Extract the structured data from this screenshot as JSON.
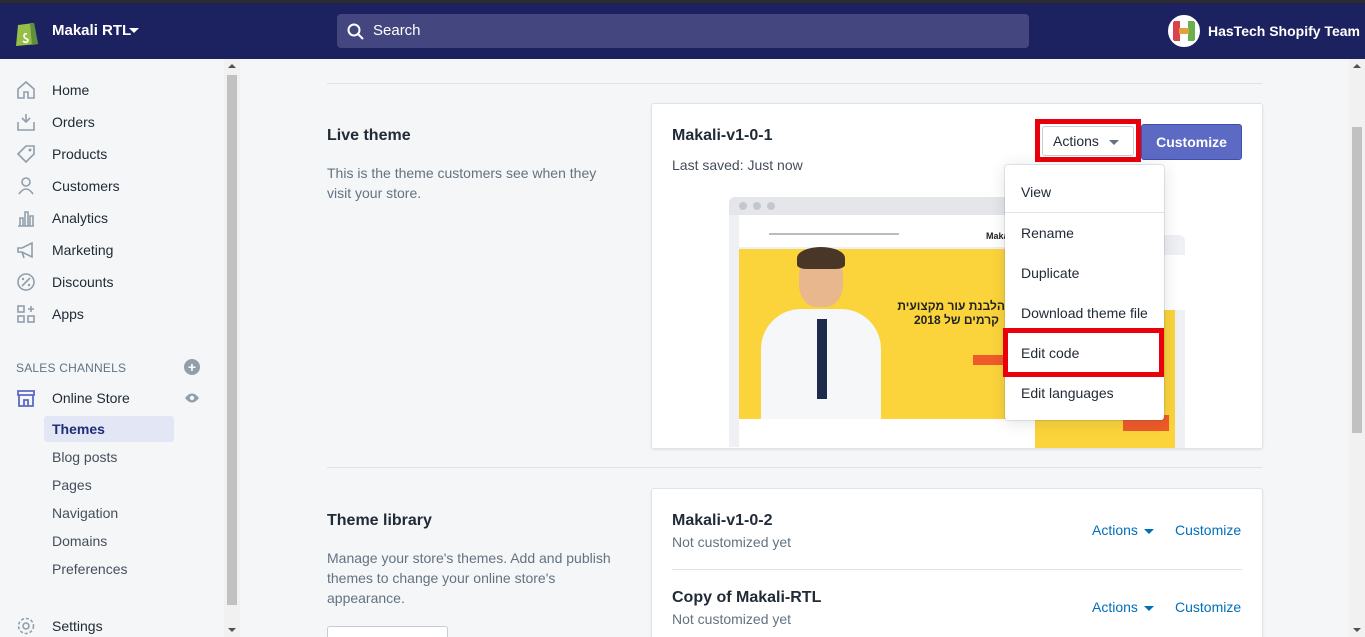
{
  "topbar": {
    "store_name": "Makali RTL",
    "search_placeholder": "Search",
    "user_name": "HasTech Shopify Team"
  },
  "sidebar": {
    "items": [
      {
        "label": "Home",
        "icon": "home-icon"
      },
      {
        "label": "Orders",
        "icon": "orders-icon"
      },
      {
        "label": "Products",
        "icon": "tag-icon"
      },
      {
        "label": "Customers",
        "icon": "customers-icon"
      },
      {
        "label": "Analytics",
        "icon": "bar-chart-icon"
      },
      {
        "label": "Marketing",
        "icon": "megaphone-icon"
      },
      {
        "label": "Discounts",
        "icon": "discount-icon"
      },
      {
        "label": "Apps",
        "icon": "apps-icon"
      }
    ],
    "sales_channels_title": "SALES CHANNELS",
    "online_store": "Online Store",
    "sub_items": [
      "Themes",
      "Blog posts",
      "Pages",
      "Navigation",
      "Domains",
      "Preferences"
    ],
    "active_sub_item": "Themes",
    "settings": "Settings"
  },
  "live_theme": {
    "heading": "Live theme",
    "description": "This is the theme customers see when they visit your store.",
    "theme_name": "Makali-v1-0-1",
    "last_saved": "Last saved: Just now",
    "actions_label": "Actions",
    "customize_label": "Customize",
    "preview_headline_1": "הלבנת עור מקצועית",
    "preview_headline_2": "קרמים של 2018",
    "preview_logo": "Makal"
  },
  "actions_menu": {
    "items": [
      "View",
      "Rename",
      "Duplicate",
      "Download theme file",
      "Edit code",
      "Edit languages"
    ]
  },
  "theme_library": {
    "heading": "Theme library",
    "description": "Manage your store's themes. Add and publish themes to change your online store's appearance.",
    "themes": [
      {
        "name": "Makali-v1-0-2",
        "status": "Not customized yet",
        "actions": "Actions",
        "customize": "Customize"
      },
      {
        "name": "Copy of Makali-RTL",
        "status": "Not customized yet",
        "actions": "Actions",
        "customize": "Customize"
      }
    ]
  },
  "colors": {
    "topbar": "#1c2260",
    "accent": "#5c6ac4",
    "link": "#006fbb",
    "highlight": "#e8000b"
  }
}
